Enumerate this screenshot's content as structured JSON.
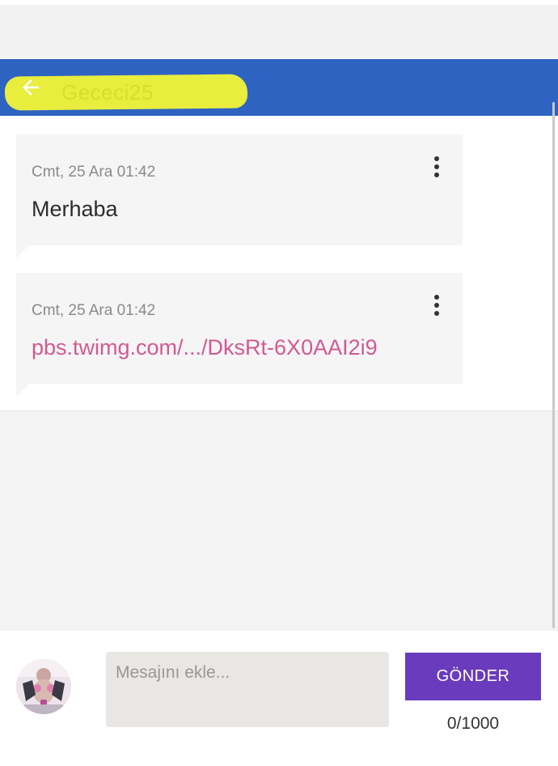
{
  "header": {
    "title": "Gececi25",
    "back_icon": "arrow-left-icon",
    "bar_color": "#2e63c2",
    "highlight_color": "#eef23a"
  },
  "messages": [
    {
      "timestamp": "Cmt, 25 Ara 01:42",
      "text": "Merhaba",
      "type": "text",
      "menu_icon": "more-vertical-icon"
    },
    {
      "timestamp": "Cmt, 25 Ara 01:42",
      "text": "pbs.twimg.com/.../DksRt-6X0AAI2i9",
      "type": "link",
      "link_color": "#d15a93",
      "menu_icon": "more-vertical-icon"
    }
  ],
  "composer": {
    "placeholder": "Mesajını ekle...",
    "value": "",
    "send_label": "GÖNDER",
    "send_color": "#6a3bbd",
    "char_count": "0/1000"
  }
}
